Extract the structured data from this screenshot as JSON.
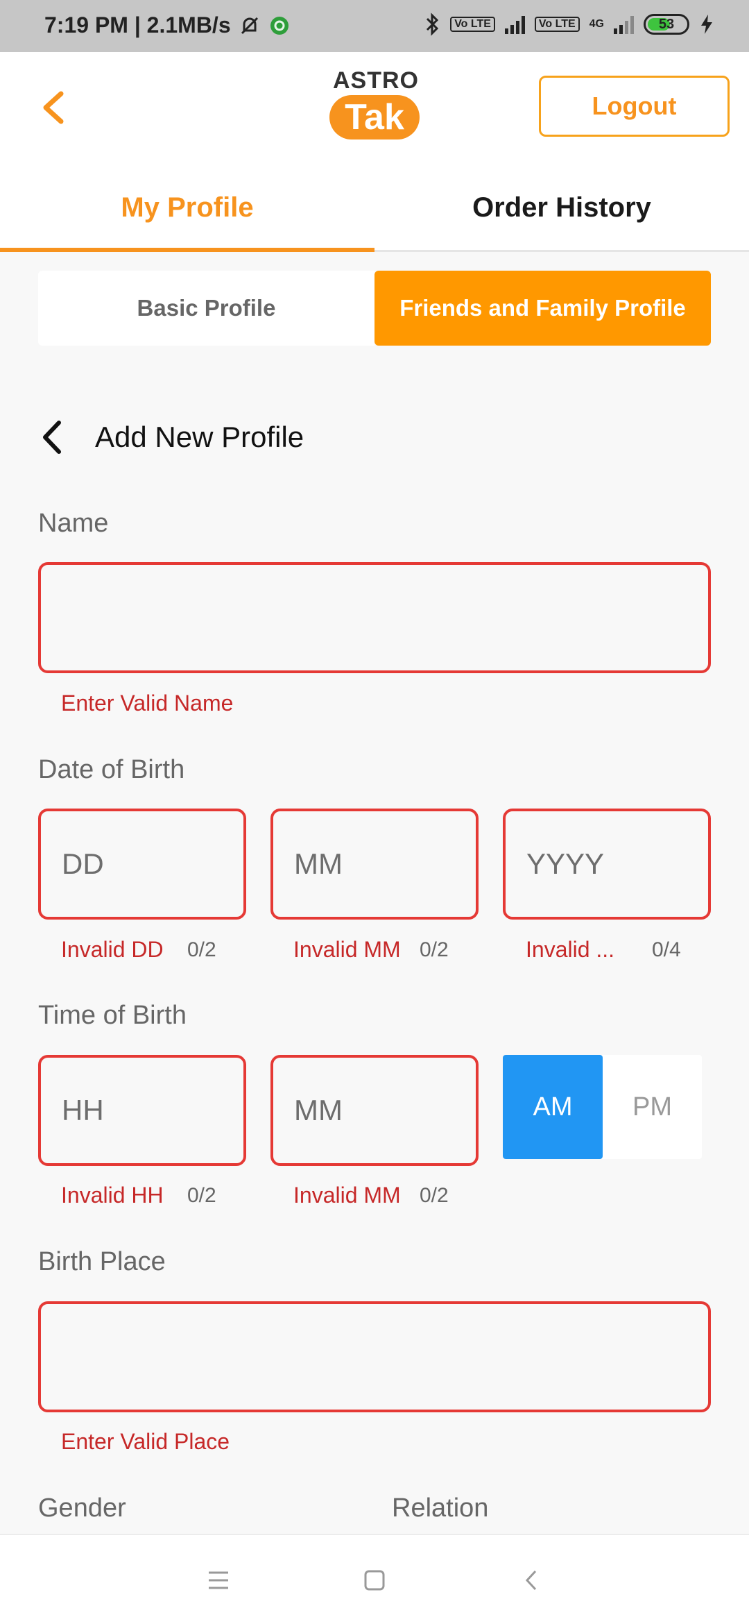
{
  "status_bar": {
    "time_speed": "7:19 PM | 2.1MB/s",
    "lte1": "Vo LTE",
    "lte2": "Vo LTE",
    "net_type": "4G",
    "battery": "53"
  },
  "header": {
    "logo_top": "ASTRO",
    "logo_bottom": "Tak",
    "logout_label": "Logout"
  },
  "tabs": {
    "my_profile": "My Profile",
    "order_history": "Order History"
  },
  "segment": {
    "basic": "Basic Profile",
    "friends": "Friends and Family Profile"
  },
  "form": {
    "title": "Add New Profile",
    "name_label": "Name",
    "name_error": "Enter Valid Name",
    "dob_label": "Date of Birth",
    "dd_placeholder": "DD",
    "mm_placeholder": "MM",
    "yyyy_placeholder": "YYYY",
    "dd_error": "Invalid DD",
    "mm_error": "Invalid MM",
    "yyyy_error": "Invalid ...",
    "dd_count": "0/2",
    "mm_count": "0/2",
    "yyyy_count": "0/4",
    "tob_label": "Time of Birth",
    "hh_placeholder": "HH",
    "min_placeholder": "MM",
    "hh_error": "Invalid HH",
    "min_error": "Invalid MM",
    "hh_count": "0/2",
    "min_count": "0/2",
    "am_label": "AM",
    "pm_label": "PM",
    "place_label": "Birth Place",
    "place_error": "Enter Valid Place",
    "gender_label": "Gender",
    "relation_label": "Relation"
  },
  "colors": {
    "brand_orange": "#f7931e",
    "error_red": "#e53935",
    "am_blue": "#2196f3"
  }
}
